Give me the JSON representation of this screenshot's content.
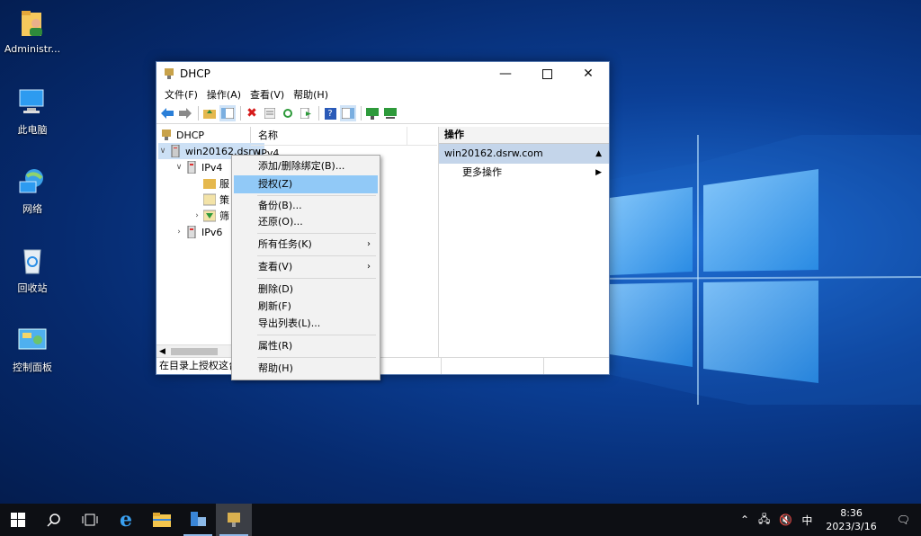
{
  "desktop": {
    "icons": [
      {
        "label": "Administr..."
      },
      {
        "label": "此电脑"
      },
      {
        "label": "网络"
      },
      {
        "label": "回收站"
      },
      {
        "label": "控制面板"
      }
    ]
  },
  "window": {
    "title": "DHCP",
    "menu": [
      "文件(F)",
      "操作(A)",
      "查看(V)",
      "帮助(H)"
    ],
    "tree": {
      "root": "DHCP",
      "server": "win20162.dsrw",
      "ipv4": "IPv4",
      "child1": "服",
      "child2": "策",
      "child3": "筛",
      "ipv6": "IPv6"
    },
    "list": {
      "column": "名称",
      "row": "IPv4"
    },
    "actions": {
      "header": "操作",
      "selected": "win20162.dsrw.com",
      "more": "更多操作"
    },
    "status": "在目录上授权这台"
  },
  "context_menu": {
    "items": [
      {
        "label": "添加/删除绑定(B)..."
      },
      {
        "label": "授权(Z)"
      },
      {
        "label": "备份(B)..."
      },
      {
        "label": "还原(O)..."
      },
      {
        "label": "所有任务(K)"
      },
      {
        "label": "查看(V)"
      },
      {
        "label": "删除(D)"
      },
      {
        "label": "刷新(F)"
      },
      {
        "label": "导出列表(L)..."
      },
      {
        "label": "属性(R)"
      },
      {
        "label": "帮助(H)"
      }
    ]
  },
  "taskbar": {
    "time": "8:36",
    "date": "2023/3/16",
    "ime": "中"
  }
}
